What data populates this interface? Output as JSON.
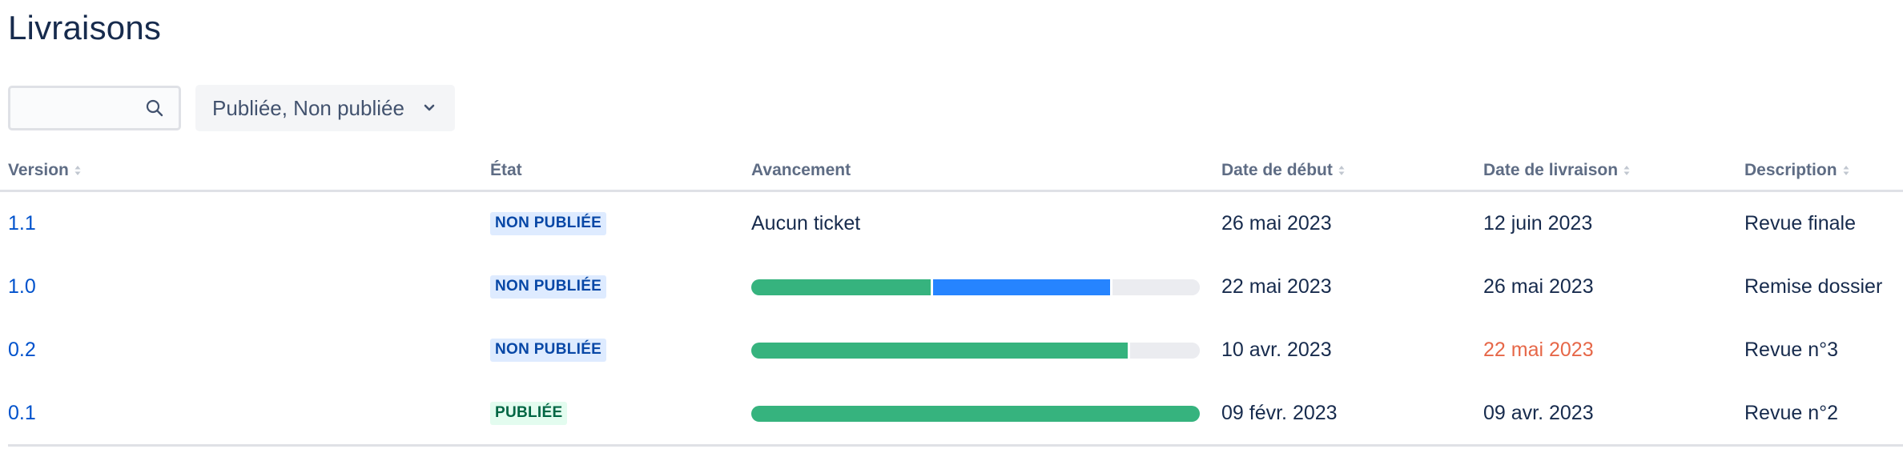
{
  "page": {
    "title": "Livraisons"
  },
  "search": {
    "placeholder": "",
    "value": ""
  },
  "filter": {
    "label": "Publiée, Non publiée"
  },
  "columns": {
    "version": "Version",
    "state": "État",
    "progress": "Avancement",
    "start_date": "Date de début",
    "release_date": "Date de livraison",
    "description": "Description"
  },
  "rows": [
    {
      "version": "1.1",
      "state": "NON PUBLIÉE",
      "state_kind": "unreleased",
      "progress_text": "Aucun ticket",
      "progress": null,
      "start_date": "26 mai 2023",
      "release_date": "12 juin 2023",
      "release_overdue": false,
      "description": "Revue finale"
    },
    {
      "version": "1.0",
      "state": "NON PUBLIÉE",
      "state_kind": "unreleased",
      "progress_text": "",
      "progress": {
        "done": 0.4,
        "in_progress": 0.4,
        "todo": 0.2
      },
      "start_date": "22 mai 2023",
      "release_date": "26 mai 2023",
      "release_overdue": false,
      "description": "Remise dossier"
    },
    {
      "version": "0.2",
      "state": "NON PUBLIÉE",
      "state_kind": "unreleased",
      "progress_text": "",
      "progress": {
        "done": 0.84,
        "in_progress": 0,
        "todo": 0.16
      },
      "start_date": "10 avr. 2023",
      "release_date": "22 mai 2023",
      "release_overdue": true,
      "description": "Revue n°3"
    },
    {
      "version": "0.1",
      "state": "PUBLIÉE",
      "state_kind": "released",
      "progress_text": "",
      "progress": {
        "done": 1.0,
        "in_progress": 0,
        "todo": 0
      },
      "start_date": "09 févr. 2023",
      "release_date": "09 avr. 2023",
      "release_overdue": false,
      "description": "Revue n°2"
    }
  ],
  "colors": {
    "done": "#36b37e",
    "in_progress": "#2684ff",
    "todo": "#ebecf0",
    "link": "#0052cc",
    "overdue": "#de350b"
  }
}
